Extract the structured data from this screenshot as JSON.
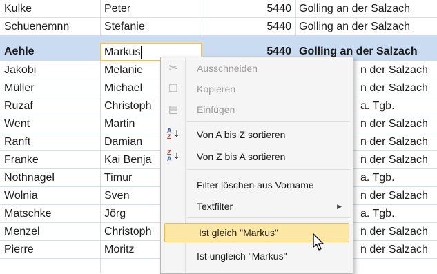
{
  "rows": [
    {
      "last": "Kulke",
      "first": "Peter",
      "zip": "5440",
      "city": "Golling an der Salzach"
    },
    {
      "last": "Schuenemnn",
      "first": "Stefanie",
      "zip": "5440",
      "city": "Golling an der Salzach"
    },
    {
      "last": "Aehle",
      "first": "",
      "zip": "5440",
      "city": "Golling an der Salzach"
    },
    {
      "last": "Jakobi",
      "first": "Melanie",
      "zip": "",
      "city": "n der Salzach"
    },
    {
      "last": "Müller",
      "first": "Michael",
      "zip": "",
      "city": "n der Salzach"
    },
    {
      "last": "Ruzaf",
      "first": "Christoph",
      "zip": "",
      "city": "a. Tgb."
    },
    {
      "last": "Went",
      "first": "Martin",
      "zip": "",
      "city": "n der Salzach"
    },
    {
      "last": "Ranft",
      "first": "Damian",
      "zip": "",
      "city": "n der Salzach"
    },
    {
      "last": "Franke",
      "first": "Kai Benja",
      "zip": "",
      "city": "n der Salzach"
    },
    {
      "last": "Nothnagel",
      "first": "Timur",
      "zip": "",
      "city": "a. Tgb."
    },
    {
      "last": "Wolnia",
      "first": "Sven",
      "zip": "",
      "city": "n der Salzach"
    },
    {
      "last": "Matschke",
      "first": "Jörg",
      "zip": "",
      "city": "a. Tgb."
    },
    {
      "last": "Menzel",
      "first": "Christoph",
      "zip": "",
      "city": "n der Salzach"
    },
    {
      "last": "Pierre",
      "first": "Moritz",
      "zip": "",
      "city": "n der Salzach"
    }
  ],
  "editor": {
    "value": "Markus"
  },
  "menu": {
    "cut": "Ausschneiden",
    "copy": "Kopieren",
    "paste": "Einfügen",
    "sort_asc": "Von A bis Z sortieren",
    "sort_desc": "Von Z bis A sortieren",
    "clear_filter": "Filter löschen aus Vorname",
    "text_filter": "Textfilter",
    "equals": "Ist gleich \"Markus\"",
    "not_equals": "Ist ungleich \"Markus\""
  },
  "icons": {
    "cut": "scissors-icon",
    "copy": "copy-icon",
    "paste": "paste-icon",
    "sort_asc": "sort-a-z-icon",
    "sort_desc": "sort-z-a-icon",
    "submenu": "chevron-right-icon",
    "cursor": "mouse-pointer-icon"
  },
  "colors": {
    "selected_row": "#c9dcf2",
    "highlight": "#fde7a5",
    "highlight_border": "#e9b94e",
    "editor_border": "#f0c05a"
  }
}
